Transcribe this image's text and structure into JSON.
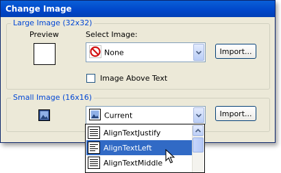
{
  "dialog": {
    "title": "Change Image",
    "close_glyph": "✕"
  },
  "large_image": {
    "group_label": "Large Image (32x32)",
    "preview_label": "Preview",
    "select_label": "Select Image:",
    "selected_value": "None",
    "selected_icon": "no-symbol-icon",
    "import_label": "Import...",
    "checkbox_label": "Image Above Text",
    "checkbox_checked": false
  },
  "small_image": {
    "group_label": "Small Image (16x16)",
    "selected_value": "Current",
    "selected_icon": "picture-icon",
    "import_label": "Import..."
  },
  "dropdown": {
    "items": [
      {
        "label": "AlignTextJustify",
        "icon": "align-justify-icon",
        "selected": false
      },
      {
        "label": "AlignTextLeft",
        "icon": "align-left-icon",
        "selected": true
      },
      {
        "label": "AlignTextMiddle",
        "icon": "align-middle-icon",
        "selected": false
      }
    ]
  },
  "colors": {
    "titlebar": "#0046c9",
    "group_label": "#0046d5",
    "selection": "#316ac5",
    "dialog_bg": "#ece9d8"
  }
}
